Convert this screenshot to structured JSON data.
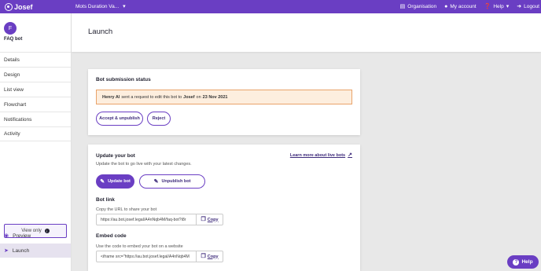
{
  "topbar": {
    "brand": "Josef",
    "bot_select": "Mots Duration Va...",
    "organisation": "Organisation",
    "my_account": "My account",
    "help": "Help",
    "logout": "Logout"
  },
  "sidebar": {
    "avatar_initial": "F",
    "bot_name": "FAQ bot",
    "items": [
      {
        "label": "Details"
      },
      {
        "label": "Design"
      },
      {
        "label": "List view"
      },
      {
        "label": "Flowchart"
      },
      {
        "label": "Notifications"
      },
      {
        "label": "Activity"
      }
    ],
    "view_only": "View only",
    "preview": "Preview",
    "launch": "Launch"
  },
  "header": {
    "title": "Launch"
  },
  "submission": {
    "title": "Bot submission status",
    "requester": "Henry Al",
    "notice_middle": "sent a request to edit this bot to",
    "target": "Josef",
    "notice_on": "on",
    "date": "23 Nov 2021",
    "accept_label": "Accept & unpublish",
    "reject_label": "Reject"
  },
  "update": {
    "title": "Update your bot",
    "subtitle": "Update the bot to go live with your latest changes.",
    "learn_more": "Learn more about live bots",
    "update_label": "Update bot",
    "unpublish_label": "Unpublish bot",
    "bot_link_title": "Bot link",
    "bot_link_desc": "Copy the URL to share your bot",
    "bot_link_url": "https://au.bot.josef.legal/A4nNqb4M/faq-bot?i8r",
    "copy_label": "Copy",
    "embed_title": "Embed code",
    "embed_desc": "Use the code to embed your bot on a website",
    "embed_code": "<iframe src=\"https://au.bot.josef.legal/A4nNqb4M",
    "embed_copy_label": "Copy"
  },
  "help_fab": {
    "label": "Help"
  },
  "colors": {
    "brand": "#6a3ec3",
    "notice_bg": "#fdeede",
    "notice_border": "#e9a36a"
  }
}
